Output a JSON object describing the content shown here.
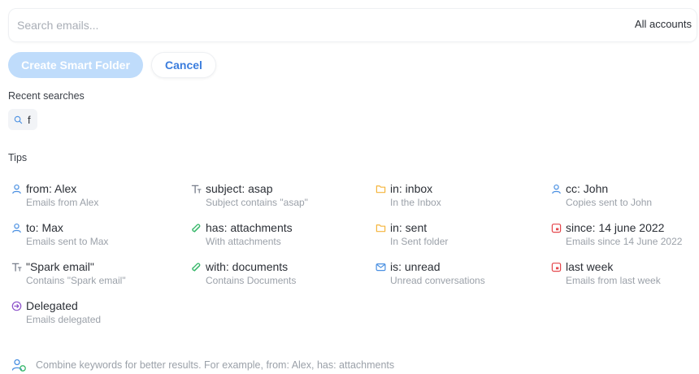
{
  "search": {
    "placeholder": "Search emails...",
    "value": ""
  },
  "accounts": {
    "selected": "All accounts"
  },
  "buttons": {
    "create_smart_folder": "Create Smart Folder",
    "cancel": "Cancel"
  },
  "recent": {
    "label": "Recent searches",
    "items": [
      {
        "text": "f"
      }
    ]
  },
  "tips": {
    "label": "Tips",
    "items": [
      {
        "title": "from: Alex",
        "desc": "Emails from Alex",
        "icon": "person-icon"
      },
      {
        "title": "subject: asap",
        "desc": "Subject contains \"asap\"",
        "icon": "text-icon"
      },
      {
        "title": "in: inbox",
        "desc": "In the Inbox",
        "icon": "folder-icon"
      },
      {
        "title": "cc: John",
        "desc": "Copies sent to John",
        "icon": "person-icon"
      },
      {
        "title": "to: Max",
        "desc": "Emails sent to Max",
        "icon": "person-icon"
      },
      {
        "title": "has: attachments",
        "desc": "With attachments",
        "icon": "paperclip-icon"
      },
      {
        "title": "in: sent",
        "desc": "In Sent folder",
        "icon": "folder-icon"
      },
      {
        "title": "since: 14 june 2022",
        "desc": "Emails since 14 June 2022",
        "icon": "calendar-icon"
      },
      {
        "title": "\"Spark email\"",
        "desc": "Contains \"Spark email\"",
        "icon": "text-icon"
      },
      {
        "title": "with: documents",
        "desc": "Contains Documents",
        "icon": "paperclip-icon"
      },
      {
        "title": "is: unread",
        "desc": "Unread conversations",
        "icon": "envelope-icon"
      },
      {
        "title": "last week",
        "desc": "Emails from last week",
        "icon": "calendar-icon"
      },
      {
        "title": "Delegated",
        "desc": "Emails delegated",
        "icon": "delegate-icon"
      }
    ]
  },
  "footer": {
    "text": "Combine keywords for better results. For example, from: Alex, has: attachments"
  },
  "colors": {
    "accent": "#3b7ddd",
    "primary_disabled": "#bfdcfb",
    "person_icon": "#4a90e2",
    "folder_icon": "#f5b53d",
    "paperclip_icon": "#39b86b",
    "envelope_icon": "#4a90e2",
    "calendar_icon": "#e5484d",
    "delegate_icon": "#8b4fc9"
  }
}
